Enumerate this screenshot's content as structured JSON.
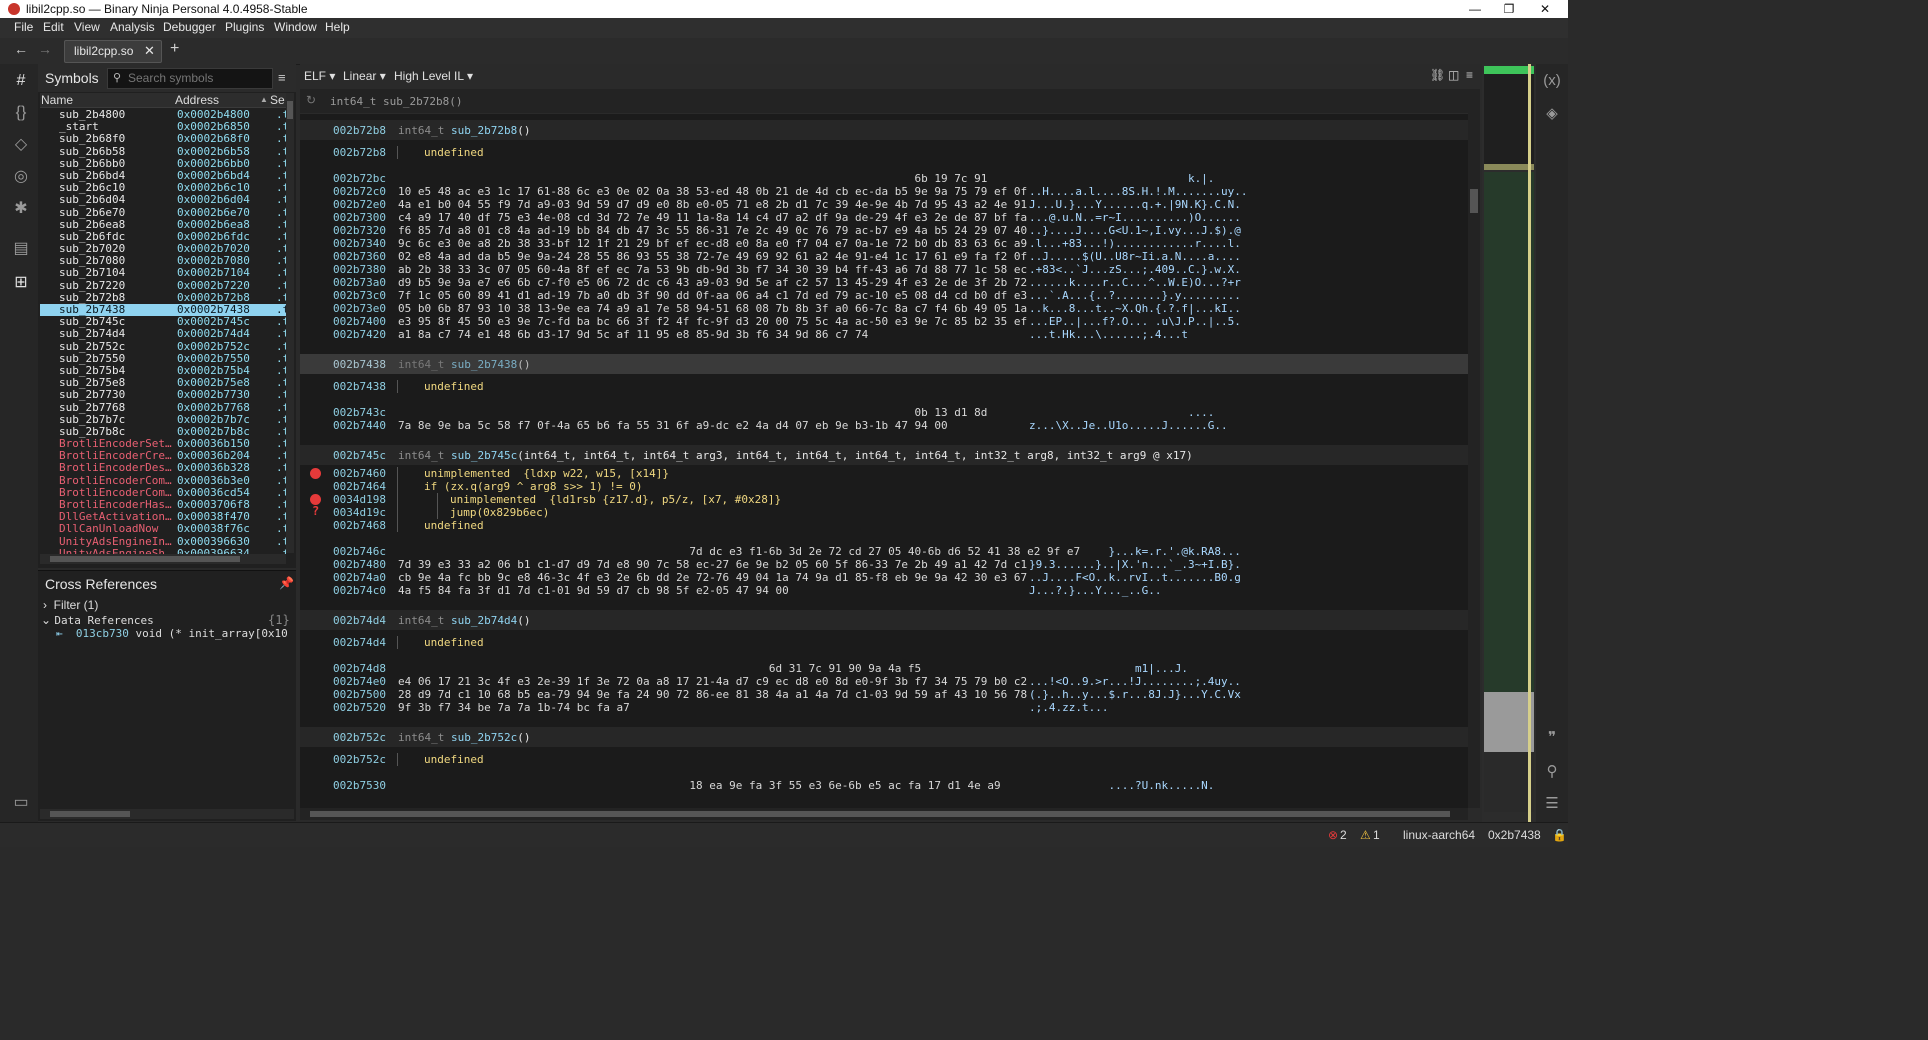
{
  "window": {
    "title": "libil2cpp.so — Binary Ninja Personal 4.0.4958-Stable"
  },
  "menu": [
    "File",
    "Edit",
    "View",
    "Analysis",
    "Debugger",
    "Plugins",
    "Window",
    "Help"
  ],
  "tab": {
    "label": "libil2cpp.so"
  },
  "symbols": {
    "title": "Symbols",
    "search_placeholder": "Search symbols",
    "columns": [
      "Name",
      "Address",
      "Se"
    ],
    "rows": [
      {
        "name": "sub_2b4800",
        "addr": "0x0002b4800",
        "sec": ".t"
      },
      {
        "name": "_start",
        "addr": "0x0002b6850",
        "sec": ".t"
      },
      {
        "name": "sub_2b68f0",
        "addr": "0x0002b68f0",
        "sec": ".t"
      },
      {
        "name": "sub_2b6b58",
        "addr": "0x0002b6b58",
        "sec": ".t"
      },
      {
        "name": "sub_2b6bb0",
        "addr": "0x0002b6bb0",
        "sec": ".t"
      },
      {
        "name": "sub_2b6bd4",
        "addr": "0x0002b6bd4",
        "sec": ".t"
      },
      {
        "name": "sub_2b6c10",
        "addr": "0x0002b6c10",
        "sec": ".t"
      },
      {
        "name": "sub_2b6d04",
        "addr": "0x0002b6d04",
        "sec": ".t"
      },
      {
        "name": "sub_2b6e70",
        "addr": "0x0002b6e70",
        "sec": ".t"
      },
      {
        "name": "sub_2b6ea8",
        "addr": "0x0002b6ea8",
        "sec": ".t"
      },
      {
        "name": "sub_2b6fdc",
        "addr": "0x0002b6fdc",
        "sec": ".t"
      },
      {
        "name": "sub_2b7020",
        "addr": "0x0002b7020",
        "sec": ".t"
      },
      {
        "name": "sub_2b7080",
        "addr": "0x0002b7080",
        "sec": ".t"
      },
      {
        "name": "sub_2b7104",
        "addr": "0x0002b7104",
        "sec": ".t"
      },
      {
        "name": "sub_2b7220",
        "addr": "0x0002b7220",
        "sec": ".t"
      },
      {
        "name": "sub_2b72b8",
        "addr": "0x0002b72b8",
        "sec": ".t"
      },
      {
        "name": "sub_2b7438",
        "addr": "0x0002b7438",
        "sec": ".t"
      },
      {
        "name": "sub_2b745c",
        "addr": "0x0002b745c",
        "sec": ".t"
      },
      {
        "name": "sub_2b74d4",
        "addr": "0x0002b74d4",
        "sec": ".t"
      },
      {
        "name": "sub_2b752c",
        "addr": "0x0002b752c",
        "sec": ".t"
      },
      {
        "name": "sub_2b7550",
        "addr": "0x0002b7550",
        "sec": ".t"
      },
      {
        "name": "sub_2b75b4",
        "addr": "0x0002b75b4",
        "sec": ".t"
      },
      {
        "name": "sub_2b75e8",
        "addr": "0x0002b75e8",
        "sec": ".t"
      },
      {
        "name": "sub_2b7730",
        "addr": "0x0002b7730",
        "sec": ".t"
      },
      {
        "name": "sub_2b7768",
        "addr": "0x0002b7768",
        "sec": ".t"
      },
      {
        "name": "sub_2b7b7c",
        "addr": "0x0002b7b7c",
        "sec": ".t"
      },
      {
        "name": "sub_2b7b8c",
        "addr": "0x0002b7b8c",
        "sec": ".t"
      },
      {
        "name": "BrotliEncoderSet…",
        "addr": "0x00036b150",
        "sec": ".t"
      },
      {
        "name": "BrotliEncoderCre…",
        "addr": "0x00036b204",
        "sec": ".t"
      },
      {
        "name": "BrotliEncoderDes…",
        "addr": "0x00036b328",
        "sec": ".t"
      },
      {
        "name": "BrotliEncoderCom…",
        "addr": "0x00036b3e0",
        "sec": ".t"
      },
      {
        "name": "BrotliEncoderCom…",
        "addr": "0x00036cd54",
        "sec": ".t"
      },
      {
        "name": "BrotliEncoderHas…",
        "addr": "0x0003706f8",
        "sec": ".t"
      },
      {
        "name": "DllGetActivation…",
        "addr": "0x00038f470",
        "sec": ".t"
      },
      {
        "name": "DllCanUnloadNow",
        "addr": "0x00038f76c",
        "sec": ".t"
      },
      {
        "name": "UnityAdsEngineIn…",
        "addr": "0x000396630",
        "sec": ".t"
      },
      {
        "name": "UnityAdsEngineSh…",
        "addr": "0x000396634",
        "sec": ".t"
      }
    ]
  },
  "xrefs": {
    "title": "Cross References",
    "filter": "Filter (1)",
    "group": "Data References",
    "count": "{1}",
    "entry_addr": "013cb730",
    "entry_text": "void (* init_array[0x10"
  },
  "view": {
    "format": "ELF",
    "mode": "Linear",
    "il": "High Level IL",
    "header_signature": "int64_t sub_2b72b8()"
  },
  "listing": [
    {
      "kind": "fn",
      "addr": "002b72b8",
      "ret": "int64_t",
      "name": "sub_2b72b8",
      "params": "()"
    },
    {
      "kind": "undef",
      "addr": "002b72b8"
    },
    {
      "kind": "hex",
      "rows": [
        [
          "002b72bc",
          "                                                                              6b 19 7c 91",
          "                        k.|."
        ],
        [
          "002b72c0",
          "10 e5 48 ac e3 1c 17 61-88 6c e3 0e 02 0a 38 53-ed 48 0b 21 de 4d cb ec-da b5 9e 9a 75 79 ef 0f",
          "..H....a.l....8S.H.!.M.......uy.."
        ],
        [
          "002b72e0",
          "4a e1 b0 04 55 f9 7d a9-03 9d 59 d7 d9 e0 8b e0-05 71 e8 2b d1 7c 39 4e-9e 4b 7d 95 43 a2 4e 91",
          "J...U.}...Y......q.+.|9N.K}.C.N."
        ],
        [
          "002b7300",
          "c4 a9 17 40 df 75 e3 4e-08 cd 3d 72 7e 49 11 1a-8a 14 c4 d7 a2 df 9a de-29 4f e3 2e de 87 bf fa",
          "...@.u.N..=r~I..........)O......"
        ],
        [
          "002b7320",
          "f6 85 7d a8 01 c8 4a ad-19 bb 84 db 47 3c 55 86-31 7e 2c 49 0c 76 79 ac-b7 e9 4a b5 24 29 07 40",
          "..}....J....G<U.1~,I.vy...J.$).@"
        ],
        [
          "002b7340",
          "9c 6c e3 0e a8 2b 38 33-bf 12 1f 21 29 bf ef ec-d8 e0 8a e0 f7 04 e7 0a-1e 72 b0 db 83 63 6c a9",
          ".l...+83...!)............r....l."
        ],
        [
          "002b7360",
          "02 e8 4a ad da b5 9e 9a-24 28 55 86 93 55 38 72-7e 49 69 92 61 a2 4e 91-e4 1c 17 61 e9 fa f2 0f",
          "..J.....$(U..U8r~Ii.a.N....a...."
        ],
        [
          "002b7380",
          "ab 2b 38 33 3c 07 05 60-4a 8f ef ec 7a 53 9b db-9d 3b f7 34 30 39 b4 ff-43 a6 7d 88 77 1c 58 ec",
          ".+83<..`J...zS...;.409..C.}.w.X."
        ],
        [
          "002b73a0",
          "d9 b5 9e 9a e7 e6 6b c7-f0 e5 06 72 dc c6 43 a9-03 9d 5e af c2 57 13 45-29 4f e3 2e de 3f 2b 72",
          "......k....r..C...^..W.E)O...?+r"
        ],
        [
          "002b73c0",
          "7f 1c 05 60 89 41 d1 ad-19 7b a0 db 3f 90 dd 0f-aa 06 a4 c1 7d ed 79 ac-10 e5 08 d4 cd b0 df e3",
          "...`.A...{..?.......}.y........."
        ],
        [
          "002b73e0",
          "05 b0 6b 87 93 10 38 13-9e ea 74 a9 a1 7e 58 94-51 68 08 7b 8b 3f a0 66-7c 8a c7 f4 6b 49 05 1a",
          "..k...8...t..~X.Qh.{.?.f|...kI.."
        ],
        [
          "002b7400",
          "e3 95 8f 45 50 e3 9e 7c-fd ba bc 66 3f f2 4f fc-9f d3 20 00 75 5c 4a ac-50 e3 9e 7c 85 b2 35 ef",
          "...EP..|...f?.O... .u\\J.P..|..5."
        ],
        [
          "002b7420",
          "a1 8a c7 74 e1 48 6b d3-17 9d 5c af 11 95 e8 85-9d 3b f6 34 9d 86 c7 74",
          "...t.Hk...\\......;.4...t"
        ]
      ]
    },
    {
      "kind": "fn",
      "addr": "002b7438",
      "ret": "int64_t",
      "name": "sub_2b7438",
      "params": "()",
      "selected": true
    },
    {
      "kind": "undef",
      "addr": "002b7438"
    },
    {
      "kind": "hex",
      "rows": [
        [
          "002b743c",
          "                                                                              0b 13 d1 8d",
          "                        ...."
        ],
        [
          "002b7440",
          "7a 8e 9e ba 5c 58 f7 0f-4a 65 b6 fa 55 31 6f a9-dc e2 4a d4 07 eb 9e b3-1b 47 94 00",
          "z...\\X..Je..U1o.....J......G.."
        ]
      ]
    },
    {
      "kind": "fn",
      "addr": "002b745c",
      "ret": "int64_t",
      "name": "sub_2b745c",
      "params": "(int64_t, int64_t, int64_t arg3, int64_t, int64_t, int64_t, int64_t, int32_t arg8, int32_t arg9 @ x17)"
    },
    {
      "kind": "code",
      "rows": [
        {
          "mark": "err",
          "addr": "002b7460",
          "indent": 0,
          "text": "unimplemented  {ldxp w22, w15, [x14]}",
          "t": "kw"
        },
        {
          "mark": "",
          "addr": "002b7464",
          "indent": 0,
          "text": "if (zx.q(arg9 ^ arg8 s>> 1) != 0)",
          "t": "kw"
        },
        {
          "mark": "err",
          "addr": "0034d198",
          "indent": 1,
          "text": "unimplemented  {ld1rsb {z17.d}, p5/z, [x7, #0x28]}",
          "t": "kw"
        },
        {
          "mark": "q",
          "addr": "0034d19c",
          "indent": 1,
          "text": "jump(0x829b6ec)",
          "t": "kw"
        },
        {
          "mark": "",
          "addr": "002b7468",
          "indent": 0,
          "text": "undefined",
          "t": "kw"
        }
      ]
    },
    {
      "kind": "hex",
      "rows": [
        [
          "002b746c",
          "                                            7d dc e3 f1-6b 3d 2e 72 cd 27 05 40-6b d6 52 41 38 e2 9f e7",
          "            }...k=.r.'.@k.RA8..."
        ],
        [
          "002b7480",
          "7d 39 e3 33 a2 06 b1 c1-d7 d9 7d e8 90 7c 58 ec-27 6e 9e b2 05 60 5f 86-33 7e 2b 49 a1 42 7d c1",
          "}9.3......}..|X.'n...`_.3~+I.B}."
        ],
        [
          "002b74a0",
          "cb 9e 4a fc bb 9c e8 46-3c 4f e3 2e 6b dd 2e 72-76 49 04 1a 74 9a d1 85-f8 eb 9e 9a 42 30 e3 67",
          "..J....F<O..k..rvI..t.......B0.g"
        ],
        [
          "002b74c0",
          "4a f5 84 fa 3f d1 7d c1-01 9d 59 d7 cb 98 5f e2-05 47 94 00",
          "J...?.}...Y..._..G.."
        ]
      ]
    },
    {
      "kind": "fn",
      "addr": "002b74d4",
      "ret": "int64_t",
      "name": "sub_2b74d4",
      "params": "()"
    },
    {
      "kind": "undef",
      "addr": "002b74d4"
    },
    {
      "kind": "hex",
      "rows": [
        [
          "002b74d8",
          "                                                        6d 31 7c 91 90 9a 4a f5",
          "                m1|...J."
        ],
        [
          "002b74e0",
          "e4 06 17 21 3c 4f e3 2e-39 1f 3e 72 0a a8 17 21-4a d7 c9 ec d8 e0 8d e0-9f 3b f7 34 75 79 b0 c2",
          "...!<O..9.>r...!J........;.4uy.."
        ],
        [
          "002b7500",
          "28 d9 7d c1 10 68 b5 ea-79 94 9e fa 24 90 72 86-ee 81 38 4a a1 4a 7d c1-03 9d 59 af 43 10 56 78",
          "(.}..h..y...$.r...8J.J}...Y.C.Vx"
        ],
        [
          "002b7520",
          "9f 3b f7 34 be 7a 7a 1b-74 bc fa a7",
          ".;.4.zz.t..."
        ]
      ]
    },
    {
      "kind": "fn",
      "addr": "002b752c",
      "ret": "int64_t",
      "name": "sub_2b752c",
      "params": "()"
    },
    {
      "kind": "undef",
      "addr": "002b752c"
    },
    {
      "kind": "hex",
      "rows": [
        [
          "002b7530",
          "                                            18 ea 9e fa 3f 55 e3 6e-6b e5 ac fa 17 d1 4e a9",
          "            ....?U.nk.....N."
        ]
      ]
    }
  ],
  "status": {
    "errors": "2",
    "warnings": "1",
    "platform": "linux-aarch64",
    "address": "0x2b7438"
  },
  "colors": {
    "accent": "#8fd3f0",
    "keyword": "#f0d880",
    "error": "#e53a3a",
    "library": "#e85f72"
  }
}
